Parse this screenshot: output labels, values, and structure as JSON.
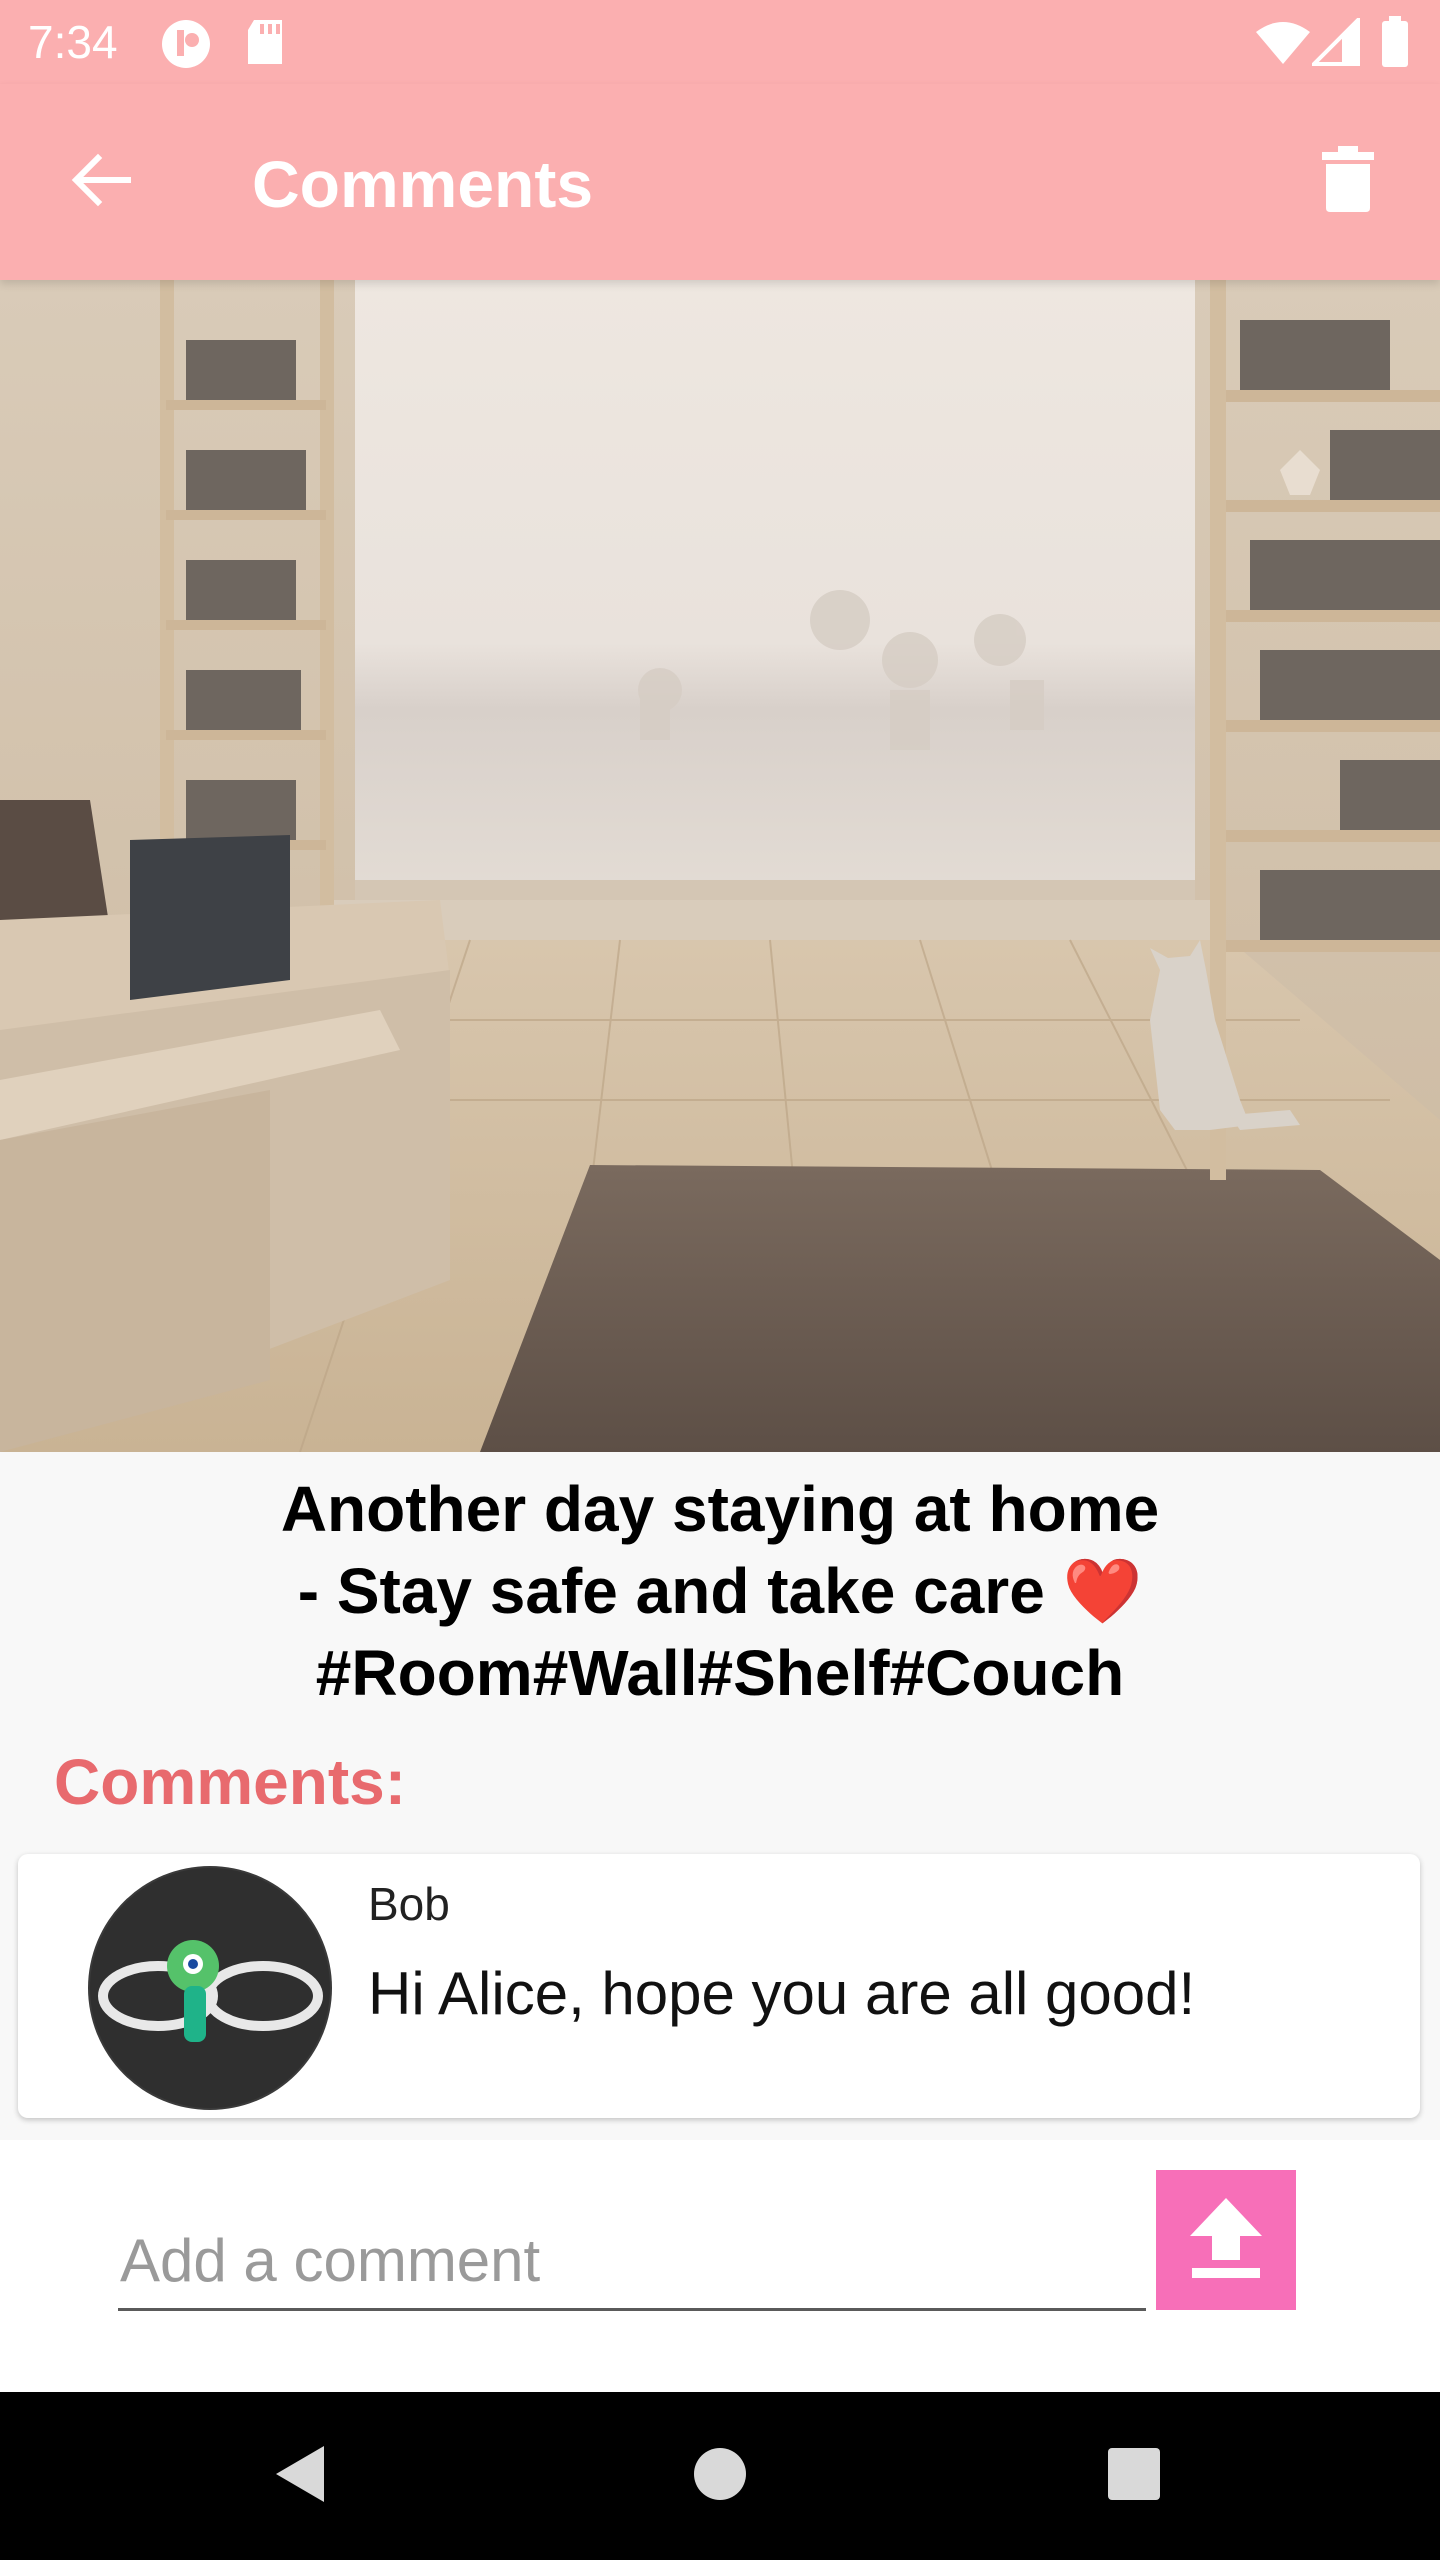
{
  "status_bar": {
    "time": "7:34",
    "icons": [
      "app-notification-icon",
      "sd-card-icon",
      "wifi-icon",
      "signal-icon",
      "battery-icon"
    ]
  },
  "app_bar": {
    "title": "Comments",
    "back_icon": "arrow-back-icon",
    "delete_icon": "trash-icon",
    "background_color": "#fbafb0"
  },
  "post": {
    "image_description_icon": "living-room-photo",
    "caption_lines": [
      "Another day staying at home",
      "- Stay safe and take care",
      "#Room#Wall#Shelf#Couch"
    ],
    "caption_emoji": "❤️"
  },
  "comments_section": {
    "label": "Comments:",
    "label_color": "#e86a6e",
    "comments": [
      {
        "author": "Bob",
        "text": "Hi Alice, hope you are all good!"
      }
    ]
  },
  "comment_input": {
    "placeholder": "Add a comment",
    "value": "",
    "send_icon": "upload-icon",
    "send_color": "#f76fb8"
  },
  "nav_bar": {
    "icons": [
      "back-triangle-icon",
      "home-circle-icon",
      "recents-square-icon"
    ]
  }
}
